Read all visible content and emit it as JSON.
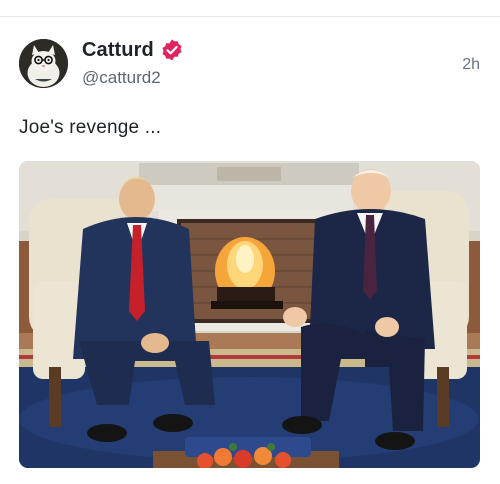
{
  "post": {
    "author": {
      "display_name": "Catturd",
      "handle": "@catturd2",
      "verified": true,
      "badge_color": "#e0245e",
      "avatar_icon": "cat-with-glasses-avatar"
    },
    "timestamp": "2h",
    "text": "Joe's revenge ...",
    "media": {
      "type": "photo",
      "icon": "photo-oval-office-fireplace"
    }
  }
}
